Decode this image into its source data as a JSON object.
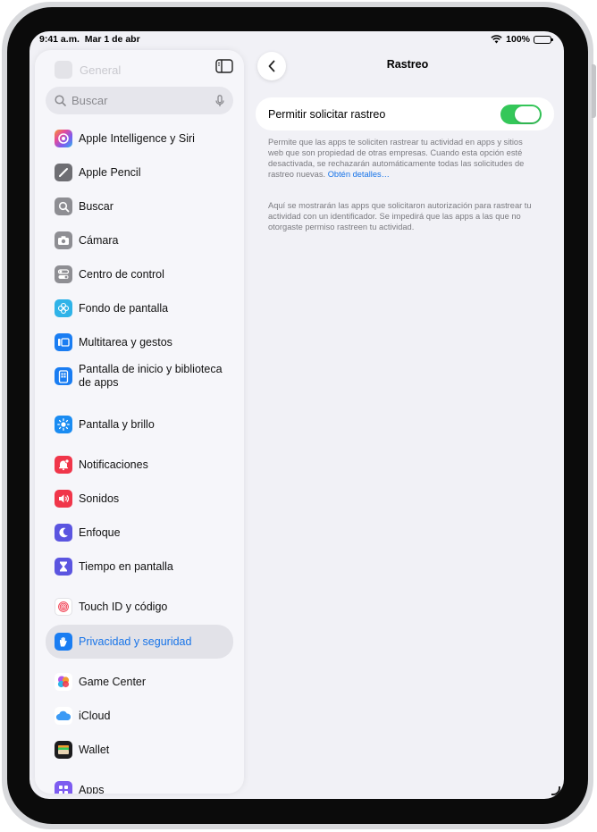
{
  "status_bar": {
    "time": "9:41 a.m.",
    "date": "Mar 1 de abr",
    "battery": "100%"
  },
  "sidebar": {
    "faded_item": "General",
    "search_placeholder": "Buscar",
    "items": [
      {
        "label": "Apple Intelligence y Siri",
        "icon": "apple-intelligence-icon",
        "color": "#b456e6"
      },
      {
        "label": "Apple Pencil",
        "icon": "pencil-icon",
        "color": "#6e6e73"
      },
      {
        "label": "Buscar",
        "icon": "magnifier-icon",
        "color": "#8e8e93"
      },
      {
        "label": "Cámara",
        "icon": "camera-icon",
        "color": "#8e8e93"
      },
      {
        "label": "Centro de control",
        "icon": "toggles-icon",
        "color": "#8e8e93"
      },
      {
        "label": "Fondo de pantalla",
        "icon": "flower-icon",
        "color": "#2fb3e8"
      },
      {
        "label": "Multitarea y gestos",
        "icon": "multitasking-icon",
        "color": "#1a7df2"
      },
      {
        "label": "Pantalla de inicio y biblioteca de apps",
        "icon": "home-screen-icon",
        "color": "#1a7df2"
      },
      {
        "label": "Pantalla y brillo",
        "icon": "sun-icon",
        "color": "#1a8cf2"
      },
      {
        "label": "Notificaciones",
        "icon": "bell-icon",
        "color": "#f0364a"
      },
      {
        "label": "Sonidos",
        "icon": "speaker-icon",
        "color": "#f0364a"
      },
      {
        "label": "Enfoque",
        "icon": "moon-icon",
        "color": "#5b55e0"
      },
      {
        "label": "Tiempo en pantalla",
        "icon": "hourglass-icon",
        "color": "#5b55e0"
      },
      {
        "label": "Touch ID y código",
        "icon": "fingerprint-icon",
        "color": "#ffffff"
      },
      {
        "label": "Privacidad y seguridad",
        "icon": "hand-icon",
        "color": "#1a7df2"
      },
      {
        "label": "Game Center",
        "icon": "game-center-icon",
        "color": "#ffffff"
      },
      {
        "label": "iCloud",
        "icon": "cloud-icon",
        "color": "#ffffff"
      },
      {
        "label": "Wallet",
        "icon": "wallet-icon",
        "color": "#1c1c1e"
      },
      {
        "label": "Apps",
        "icon": "apps-icon",
        "color": "#7d5cf0"
      }
    ],
    "selected": "Privacidad y seguridad"
  },
  "main": {
    "title": "Rastreo",
    "toggle_label": "Permitir solicitar rastreo",
    "toggle_on": true,
    "footnote_1": "Permite que las apps te soliciten rastrear tu actividad en apps y sitios web que son propiedad de otras empresas. Cuando esta opción esté desactivada, se rechazarán automáticamente todas las solicitudes de rastreo nuevas.",
    "footnote_link": "Obtén detalles…",
    "footnote_2": "Aquí se mostrarán las apps que solicitaron autorización para rastrear tu actividad con un identificador. Se impedirá que las apps a las que no otorgaste permiso rastreen tu actividad."
  },
  "colors": {
    "accent": "#1874e8",
    "switch_on": "#34c759"
  }
}
